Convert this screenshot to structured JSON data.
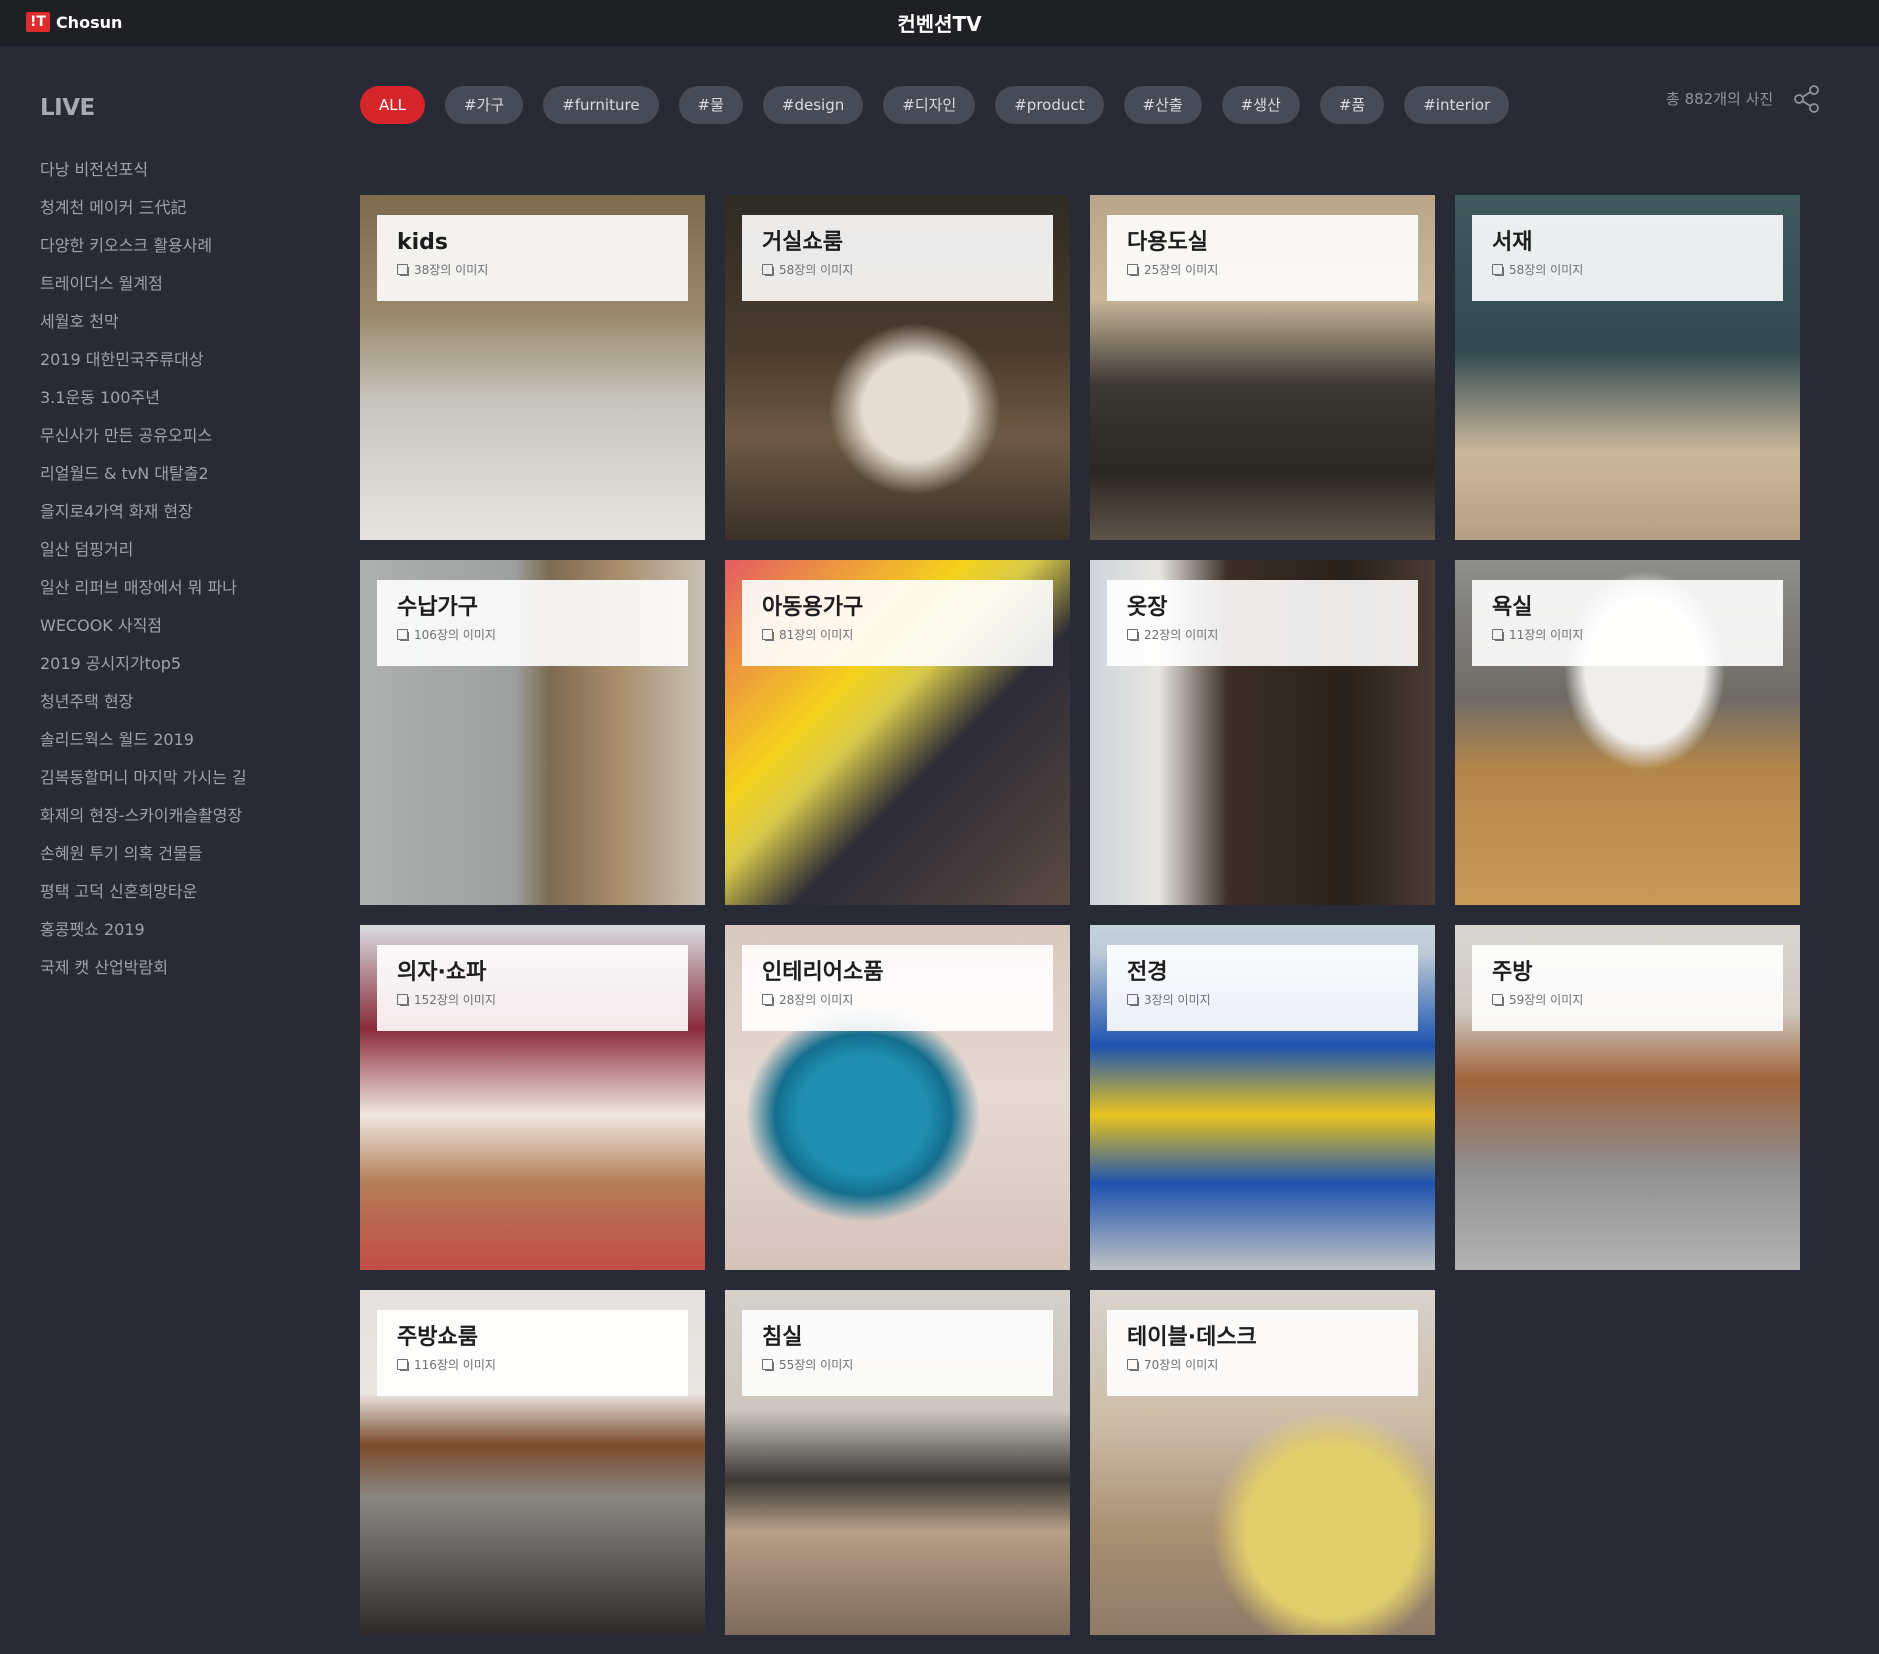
{
  "header": {
    "logo_mark": "!T",
    "logo_text": "Chosun",
    "title": "컨벤션TV"
  },
  "sidebar": {
    "heading": "LIVE",
    "items": [
      "다낭 비전선포식",
      "청계천 메이커 三代記",
      "다양한 키오스크 활용사례",
      "트레이더스 월계점",
      "세월호 천막",
      "2019 대한민국주류대상",
      "3.1운동 100주년",
      "무신사가 만든 공유오피스",
      "리얼월드 & tvN 대탈출2",
      "을지로4가역 화재 현장",
      "일산 덤핑거리",
      "일산 리퍼브 매장에서 뭐 파나",
      "WECOOK 사직점",
      "2019 공시지가top5",
      "청년주택 현장",
      "솔리드웍스 월드 2019",
      "김복동할머니 마지막 가시는 길",
      "화제의 현장-스카이캐슬촬영장",
      "손혜원 투기 의혹 건물들",
      "평택 고덕 신혼희망타운",
      "홍콩펫쇼 2019",
      "국제 캣 산업박람회"
    ]
  },
  "tags": [
    "ALL",
    "#가구",
    "#furniture",
    "#물",
    "#design",
    "#디자인",
    "#product",
    "#산출",
    "#생산",
    "#품",
    "#interior"
  ],
  "total_text": "총 882개의 사진",
  "colors": {
    "accent": "#d6262b",
    "background": "#282b35",
    "topbar": "#1f2024"
  },
  "share_icon": "share-icon",
  "albums": [
    {
      "title": "kids",
      "count": "38장의 이미지"
    },
    {
      "title": "거실쇼룸",
      "count": "58장의 이미지"
    },
    {
      "title": "다용도실",
      "count": "25장의 이미지"
    },
    {
      "title": "서재",
      "count": "58장의 이미지"
    },
    {
      "title": "수납가구",
      "count": "106장의 이미지"
    },
    {
      "title": "아동용가구",
      "count": "81장의 이미지"
    },
    {
      "title": "옷장",
      "count": "22장의 이미지"
    },
    {
      "title": "욕실",
      "count": "11장의 이미지"
    },
    {
      "title": "의자·쇼파",
      "count": "152장의 이미지"
    },
    {
      "title": "인테리어소품",
      "count": "28장의 이미지"
    },
    {
      "title": "전경",
      "count": "3장의 이미지"
    },
    {
      "title": "주방",
      "count": "59장의 이미지"
    },
    {
      "title": "주방쇼룸",
      "count": "116장의 이미지"
    },
    {
      "title": "침실",
      "count": "55장의 이미지"
    },
    {
      "title": "테이블·데스크",
      "count": "70장의 이미지"
    }
  ]
}
